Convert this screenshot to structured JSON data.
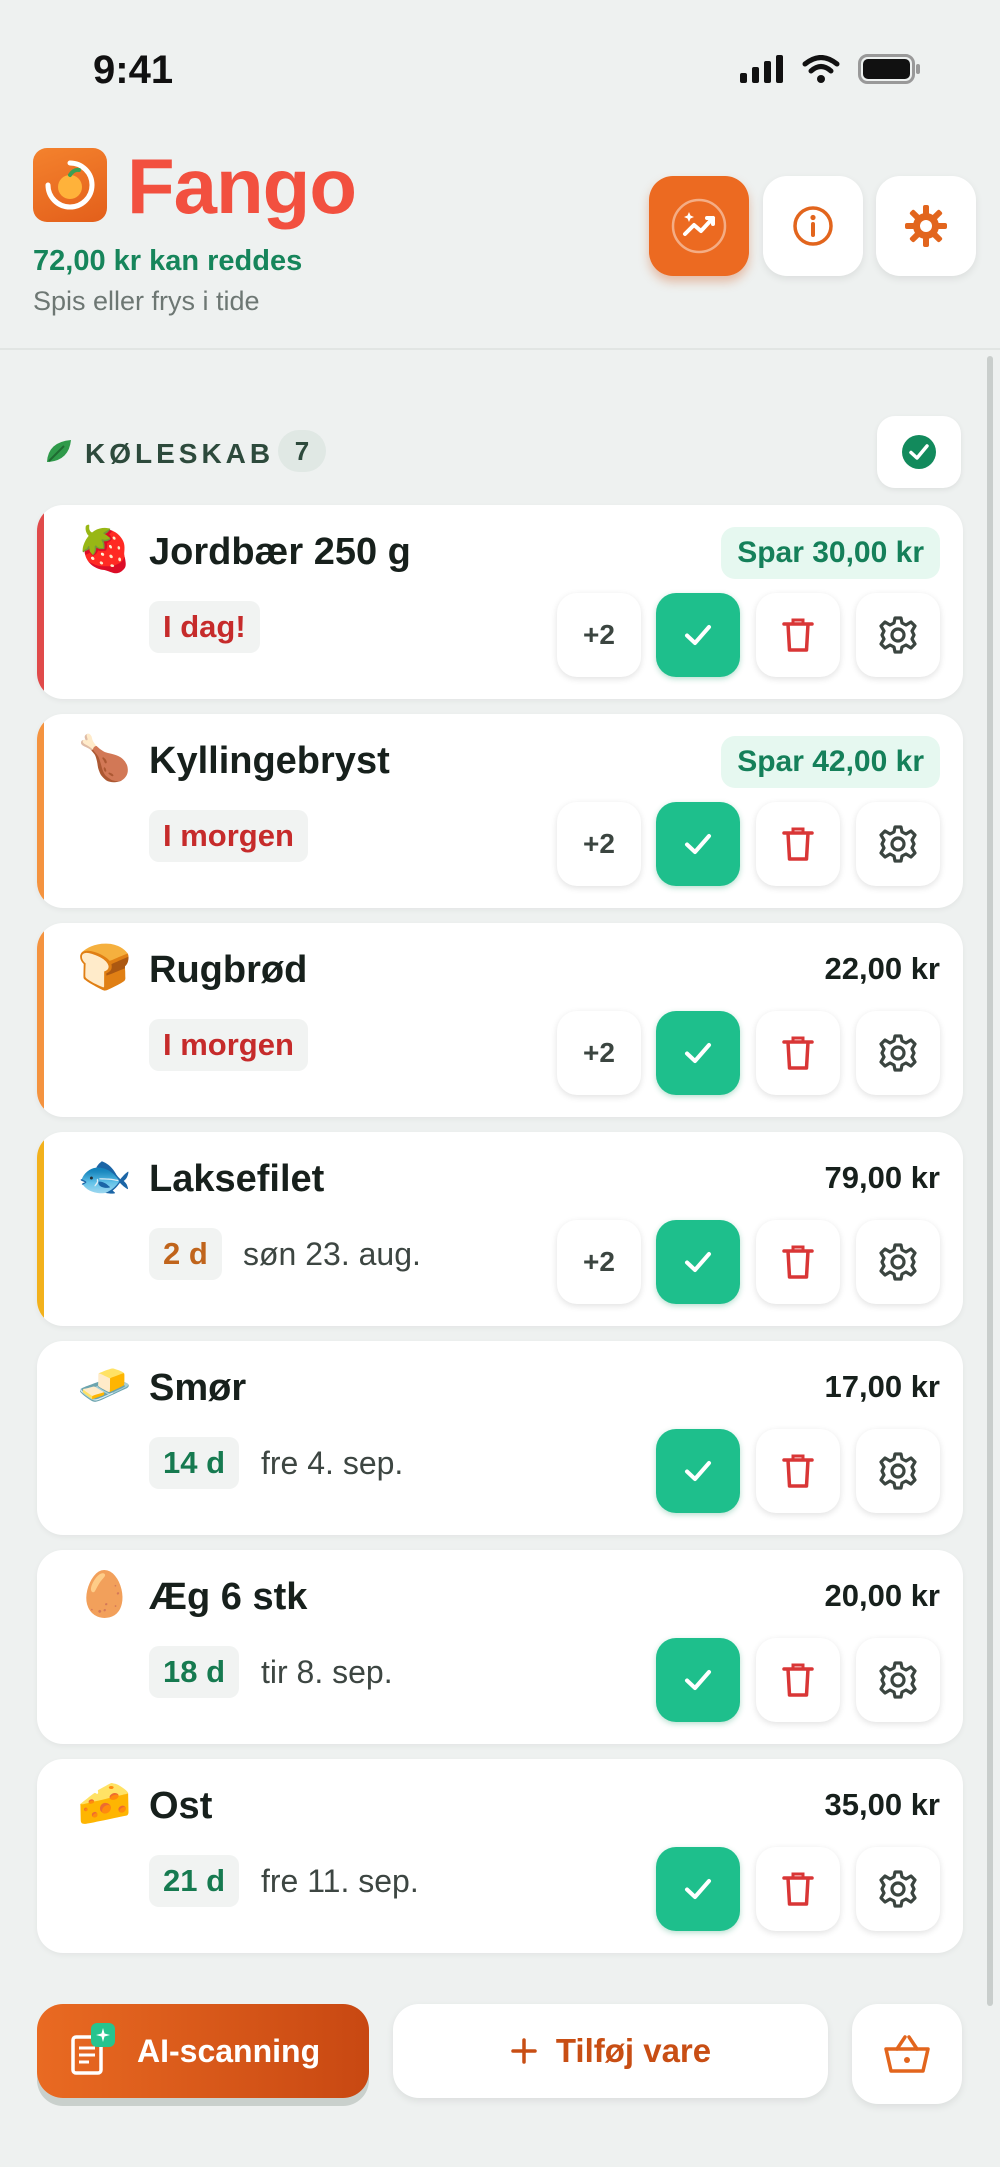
{
  "status_bar": {
    "time": "9:41"
  },
  "header": {
    "app_title": "Fango",
    "savings_line": "72,00 kr kan reddes",
    "subtitle": "Spis eller frys i tide"
  },
  "section": {
    "title": "KØLESKAB",
    "count": "7"
  },
  "items": [
    {
      "emoji": "🍓",
      "name": "Jordbær 250 g",
      "save": "Spar 30,00 kr",
      "price": "",
      "badge": "I dag!",
      "badge_tone": "red",
      "date": "",
      "extra": "+2",
      "accent": "#e04a4a"
    },
    {
      "emoji": "🍗",
      "name": "Kyllingebryst",
      "save": "Spar 42,00 kr",
      "price": "",
      "badge": "I morgen",
      "badge_tone": "red",
      "date": "",
      "extra": "+2",
      "accent": "#f4933f"
    },
    {
      "emoji": "🍞",
      "name": "Rugbrød",
      "save": "",
      "price": "22,00 kr",
      "badge": "I morgen",
      "badge_tone": "red",
      "date": "",
      "extra": "+2",
      "accent": "#f4933f"
    },
    {
      "emoji": "🐟",
      "name": "Laksefilet",
      "save": "",
      "price": "79,00 kr",
      "badge": "2 d",
      "badge_tone": "orange",
      "date": "søn 23. aug.",
      "extra": "+2",
      "accent": "#f2b11c"
    },
    {
      "emoji": "🧈",
      "name": "Smør",
      "save": "",
      "price": "17,00 kr",
      "badge": "14 d",
      "badge_tone": "green",
      "date": "fre 4. sep.",
      "extra": "",
      "accent": ""
    },
    {
      "emoji": "🥚",
      "name": "Æg 6 stk",
      "save": "",
      "price": "20,00 kr",
      "badge": "18 d",
      "badge_tone": "green",
      "date": "tir 8. sep.",
      "extra": "",
      "accent": ""
    },
    {
      "emoji": "🧀",
      "name": "Ost",
      "save": "",
      "price": "35,00 kr",
      "badge": "21 d",
      "badge_tone": "green",
      "date": "fre 11. sep.",
      "extra": "",
      "accent": ""
    }
  ],
  "bottom_bar": {
    "ai_label": "AI-scanning",
    "add_label": "Tilføj vare"
  },
  "colors": {
    "brand": "#f2503f",
    "accent_orange": "#ec6a21",
    "success": "#1ebf8c",
    "danger": "#d93636"
  },
  "icons": [
    "app-logo-icon",
    "trend-chart-icon",
    "info-icon",
    "gear-icon",
    "leaf-icon",
    "check-icon",
    "trash-icon",
    "scan-receipt-icon",
    "plus-icon",
    "basket-icon"
  ]
}
